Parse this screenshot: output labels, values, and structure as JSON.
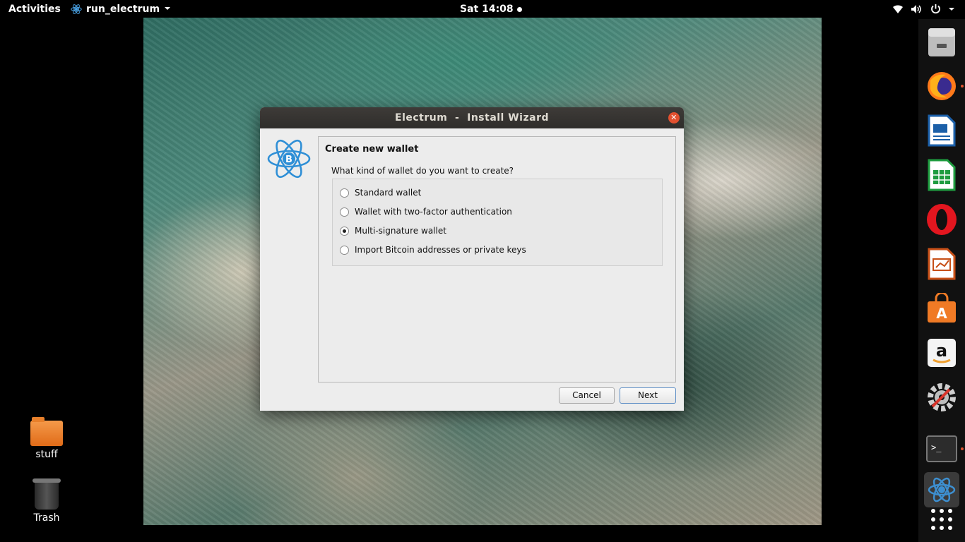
{
  "topbar": {
    "activities": "Activities",
    "app_name": "run_electrum",
    "clock": "Sat 14:08"
  },
  "desktop": {
    "icons": [
      {
        "label": "stuff"
      },
      {
        "label": "Trash"
      }
    ]
  },
  "dock": {
    "items": [
      "files",
      "firefox",
      "writer",
      "calc",
      "opera",
      "impress",
      "software-center",
      "amazon",
      "settings",
      "terminal",
      "electrum",
      "show-apps"
    ]
  },
  "window": {
    "title": "Electrum  -  Install Wizard",
    "heading": "Create new wallet",
    "question": "What kind of wallet do you want to create?",
    "options": [
      {
        "label": "Standard wallet",
        "checked": false
      },
      {
        "label": "Wallet with two-factor authentication",
        "checked": false
      },
      {
        "label": "Multi-signature wallet",
        "checked": true
      },
      {
        "label": "Import Bitcoin addresses or private keys",
        "checked": false
      }
    ],
    "cancel_label": "Cancel",
    "next_label": "Next"
  },
  "colors": {
    "accent": "#2f8fd6",
    "titlebar": "#33312e",
    "close": "#e2502f"
  }
}
